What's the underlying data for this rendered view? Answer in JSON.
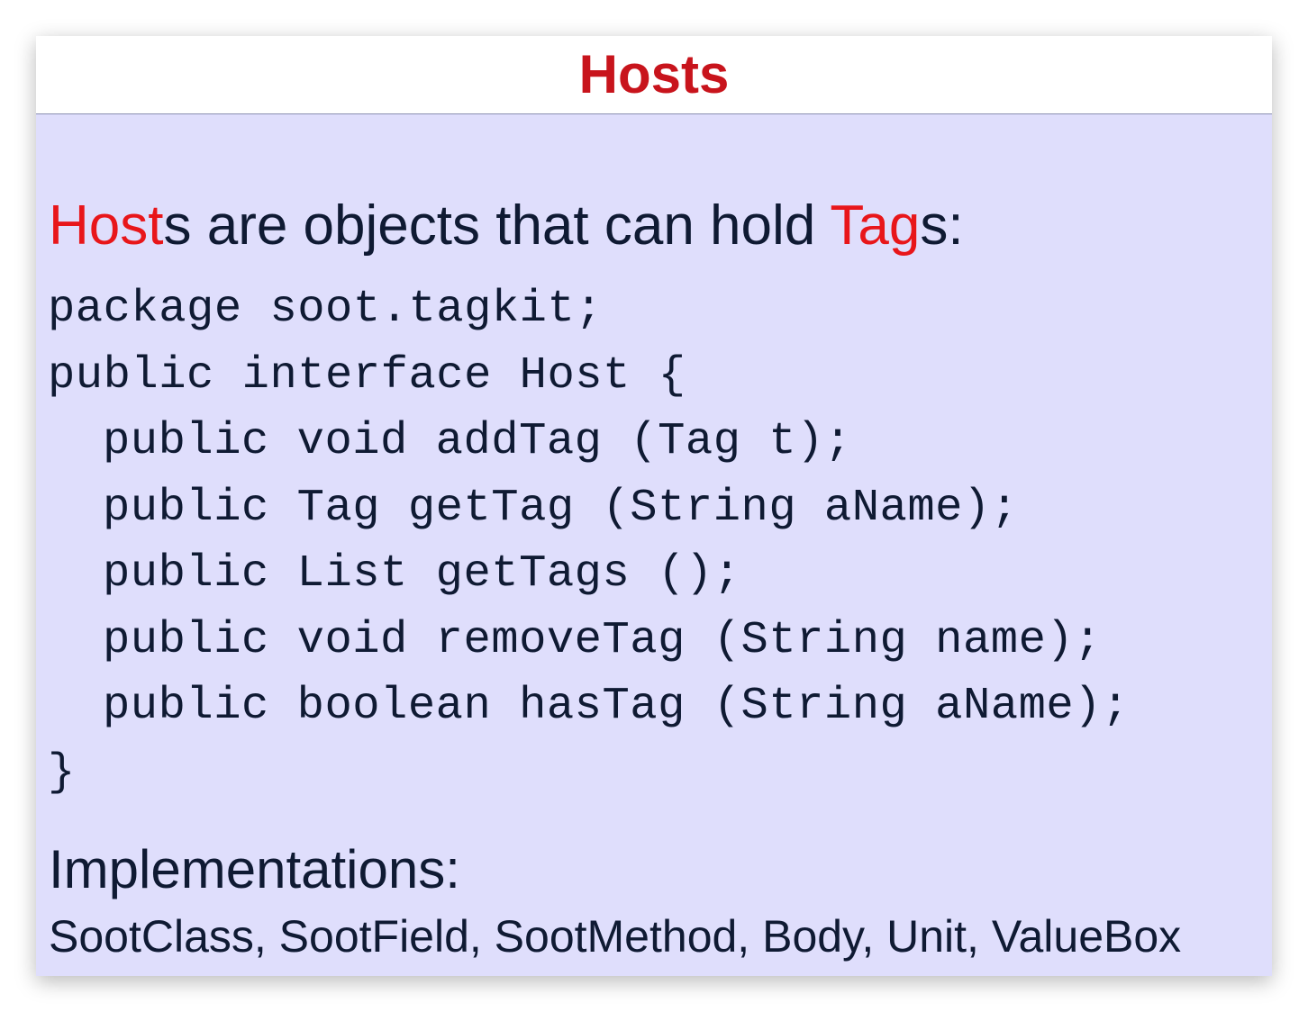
{
  "title": "Hosts",
  "intro": {
    "part1_red": "Host",
    "part2": "s are objects that can hold ",
    "part3_red": "Tag",
    "part4": "s:"
  },
  "code_lines": [
    "package soot.tagkit;",
    "public interface Host {",
    "public void addTag (Tag t);",
    "public Tag getTag (String aName);",
    "public List getTags ();",
    "public void removeTag (String name);",
    "public boolean hasTag (String aName);",
    "}"
  ],
  "implementations": {
    "heading": "Implementations:",
    "list": "SootClass, SootField, SootMethod, Body, Unit, ValueBox"
  },
  "colors": {
    "title": "#c8141c",
    "highlight": "#e8161a",
    "body_background": "#dfdefc",
    "text": "#0f1a33"
  }
}
